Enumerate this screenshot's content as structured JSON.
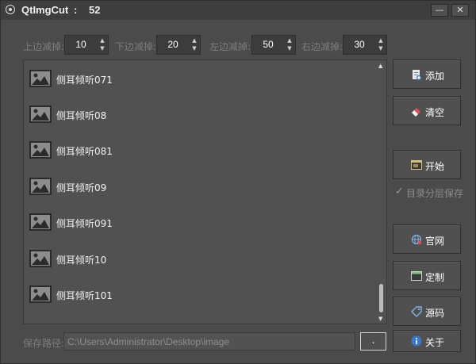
{
  "titlebar": {
    "title": "QtImgCut",
    "separator": ":",
    "count": "52",
    "minimize_glyph": "—",
    "close_glyph": "✕"
  },
  "margins": [
    {
      "label": "上边减掉:",
      "value": "10"
    },
    {
      "label": "下边减掉:",
      "value": "20"
    },
    {
      "label": "左边减掉:",
      "value": "50"
    },
    {
      "label": "右边减掉:",
      "value": "30"
    }
  ],
  "spin_glyphs": {
    "up": "▲",
    "down": "▼"
  },
  "file_list": {
    "items": [
      "侧耳倾听071",
      "侧耳倾听08",
      "侧耳倾听081",
      "侧耳倾听09",
      "侧耳倾听091",
      "侧耳倾听10",
      "侧耳倾听101"
    ],
    "item_icon": "image-placeholder-icon"
  },
  "buttons": {
    "add": {
      "label": "添加",
      "icon": "add-file-icon"
    },
    "clear": {
      "label": "清空",
      "icon": "eraser-icon"
    },
    "start": {
      "label": "开始",
      "icon": "window-icon"
    },
    "website": {
      "label": "官网",
      "icon": "globe-icon"
    },
    "custom": {
      "label": "定制",
      "icon": "window-icon"
    },
    "source": {
      "label": "源码",
      "icon": "tag-icon"
    },
    "about": {
      "label": "关于",
      "icon": "info-icon"
    }
  },
  "checkbox": {
    "label": "目录分层保存",
    "checked": true,
    "mark": "✓"
  },
  "save_path": {
    "label": "保存路径:",
    "value": "C:\\Users\\Administrator\\Desktop\\image",
    "browse_label": "."
  },
  "colors": {
    "background": "#4b4b4b",
    "list_background": "#515151",
    "titlebar": "#3e3e3e"
  }
}
